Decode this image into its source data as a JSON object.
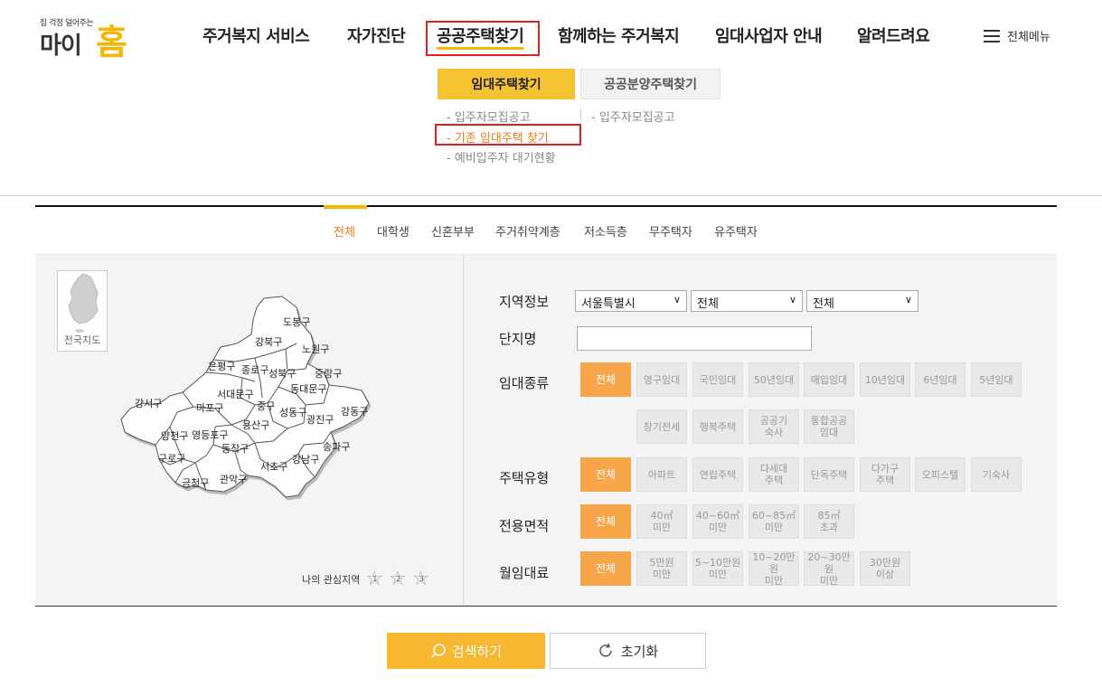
{
  "logo": {
    "tagline": "집 걱정 덜어주는",
    "brand_a": "마이",
    "brand_b": "홈"
  },
  "gnb": {
    "items": [
      "주거복지 서비스",
      "자가진단",
      "공공주택찾기",
      "함께하는 주거복지",
      "임대사업자 안내",
      "알려드려요"
    ],
    "all_menu": "전체메뉴"
  },
  "sub_tabs": [
    "임대주택찾기",
    "공공분양주택찾기"
  ],
  "sub_links_left": [
    "- 입주자모집공고",
    "- 기존 임대주택 찾기",
    "- 예비입주자 대기현황"
  ],
  "sub_links_right": [
    "- 입주자모집공고"
  ],
  "categories": [
    "전체",
    "대학생",
    "신혼부부",
    "주거취약계층",
    "저소득층",
    "무주택자",
    "유주택자"
  ],
  "map": {
    "national_label": "전국지도",
    "districts": [
      "도봉구",
      "강북구",
      "노원구",
      "은평구",
      "종로구",
      "성북구",
      "중랑구",
      "서대문구",
      "동대문구",
      "강서구",
      "마포구",
      "중구",
      "성동구",
      "광진구",
      "강동구",
      "용산구",
      "양천구",
      "영등포구",
      "동작구",
      "송파구",
      "구로구",
      "서초구",
      "강남구",
      "금천구",
      "관악구"
    ],
    "favorites_label": "나의 관심지역",
    "favorite_stars": [
      "1",
      "2",
      "3"
    ]
  },
  "filters": {
    "region_label": "지역정보",
    "region_values": [
      "서울특별시",
      "전체",
      "전체"
    ],
    "complex_label": "단지명",
    "rent_type_label": "임대종류",
    "rent_types": [
      "전체",
      "영구임대",
      "국민임대",
      "50년임대",
      "매입임대",
      "10년임대",
      "6년임대",
      "5년임대",
      "장기전세",
      "행복주택",
      "공공기\n숙사",
      "통합공공\n임대"
    ],
    "house_type_label": "주택유형",
    "house_types": [
      "전체",
      "아파트",
      "연립주택",
      "다세대\n주택",
      "단독주택",
      "다가구\n주택",
      "오피스텔",
      "기숙사"
    ],
    "area_label": "전용면적",
    "areas": [
      "전체",
      "40㎡\n미만",
      "40~60㎡\n미만",
      "60~85㎡\n미만",
      "85㎡\n초과"
    ],
    "monthly_label": "월임대료",
    "monthly": [
      "전체",
      "5만원\n미만",
      "5~10만원\n미만",
      "10~20만원\n미만",
      "20~30만원\n미만",
      "30만원\n이상"
    ]
  },
  "buttons": {
    "search": "검색하기",
    "reset": "초기화"
  },
  "colors": {
    "accent": "#f7b500",
    "active_chip": "#f8a64a",
    "highlight_box": "#e02020",
    "current_link": "#f07a18"
  }
}
